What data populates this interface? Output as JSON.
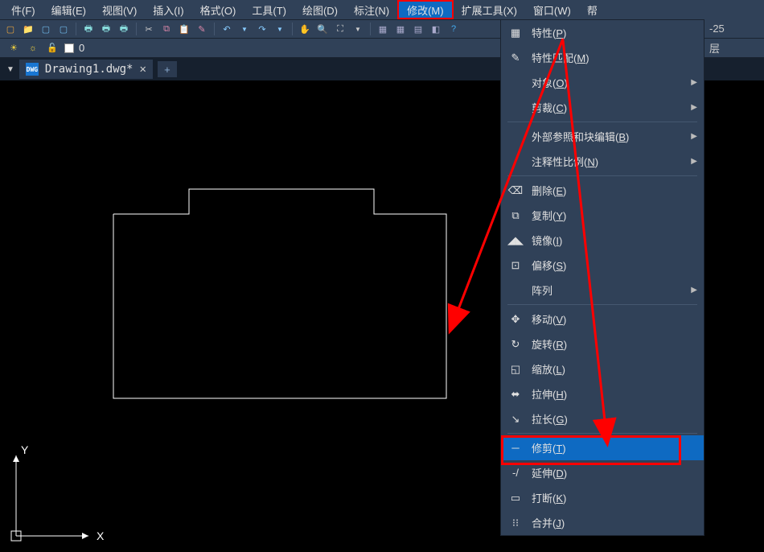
{
  "menubar": {
    "items": [
      {
        "label": "件(F)"
      },
      {
        "label": "编辑(E)"
      },
      {
        "label": "视图(V)"
      },
      {
        "label": "插入(I)"
      },
      {
        "label": "格式(O)"
      },
      {
        "label": "工具(T)"
      },
      {
        "label": "绘图(D)"
      },
      {
        "label": "标注(N)"
      },
      {
        "label": "修改(M)",
        "active": true
      },
      {
        "label": "扩展工具(X)"
      },
      {
        "label": "窗口(W)"
      },
      {
        "label": "帮"
      }
    ]
  },
  "layer_row": {
    "current_layer": "0",
    "bylayer": "随层",
    "right_val": "-25",
    "right_val2": "层"
  },
  "file_tab": {
    "name": "Drawing1.dwg*",
    "icon": "DWG"
  },
  "ucs": {
    "x_label": "X",
    "y_label": "Y"
  },
  "dropdown": {
    "items": [
      {
        "icon": "▦",
        "text": "特性(",
        "key": "P",
        "suffix": ")",
        "sub": false
      },
      {
        "icon": "✎",
        "text": "特性匹配(",
        "key": "M",
        "suffix": ")",
        "sub": false
      },
      {
        "icon": "",
        "text": "对象(",
        "key": "O",
        "suffix": ")",
        "sub": true
      },
      {
        "icon": "",
        "text": "剪裁(",
        "key": "C",
        "suffix": ")",
        "sub": true
      },
      {
        "sep": true
      },
      {
        "icon": "",
        "text": "外部参照和块编辑(",
        "key": "B",
        "suffix": ")",
        "sub": true
      },
      {
        "icon": "",
        "text": "注释性比例(",
        "key": "N",
        "suffix": ")",
        "sub": true
      },
      {
        "sep": true
      },
      {
        "icon": "⌫",
        "text": "删除(",
        "key": "E",
        "suffix": ")",
        "sub": false
      },
      {
        "icon": "⧉",
        "text": "复制(",
        "key": "Y",
        "suffix": ")",
        "sub": false
      },
      {
        "icon": "◢◣",
        "text": "镜像(",
        "key": "I",
        "suffix": ")",
        "sub": false
      },
      {
        "icon": "⊡",
        "text": "偏移(",
        "key": "S",
        "suffix": ")",
        "sub": false
      },
      {
        "icon": "",
        "text": "阵列",
        "key": "",
        "suffix": "",
        "sub": true
      },
      {
        "sep": true
      },
      {
        "icon": "✥",
        "text": "移动(",
        "key": "V",
        "suffix": ")",
        "sub": false
      },
      {
        "icon": "↻",
        "text": "旋转(",
        "key": "R",
        "suffix": ")",
        "sub": false
      },
      {
        "icon": "◱",
        "text": "缩放(",
        "key": "L",
        "suffix": ")",
        "sub": false
      },
      {
        "icon": "⬌",
        "text": "拉伸(",
        "key": "H",
        "suffix": ")",
        "sub": false
      },
      {
        "icon": "↘",
        "text": "拉长(",
        "key": "G",
        "suffix": ")",
        "sub": false
      },
      {
        "sep": true
      },
      {
        "icon": "─",
        "text": "修剪(",
        "key": "T",
        "suffix": ")",
        "sub": false,
        "highlight": true,
        "boxed": true
      },
      {
        "icon": "-/",
        "text": "延伸(",
        "key": "D",
        "suffix": ")",
        "sub": false
      },
      {
        "icon": "▭",
        "text": "打断(",
        "key": "K",
        "suffix": ")",
        "sub": false
      },
      {
        "icon": "⁝⁝",
        "text": "合并(",
        "key": "J",
        "suffix": ")",
        "sub": false
      }
    ]
  }
}
